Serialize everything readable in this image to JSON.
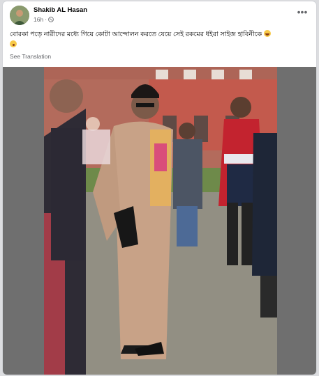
{
  "post": {
    "author": "Shakib AL Hasan",
    "time": "16h",
    "privacy_icon": "globe-icon",
    "more_icon": "more-options-icon",
    "caption": "বোরকা পড়ে নারীদের মধ্যে গিয়ে কোটা আন্দোলন করতে যেয়ে সেই রকমের ধইরা সাইজ হাবিনীকে",
    "caption_emojis": [
      "grinning-face-icon",
      "astonished-face-icon"
    ],
    "see_translation": "See Translation"
  },
  "photo": {
    "description_icon": "post-photo"
  },
  "colors": {
    "name": "#050505",
    "meta": "#65676b",
    "photo_bg": "#6f6f6f"
  }
}
